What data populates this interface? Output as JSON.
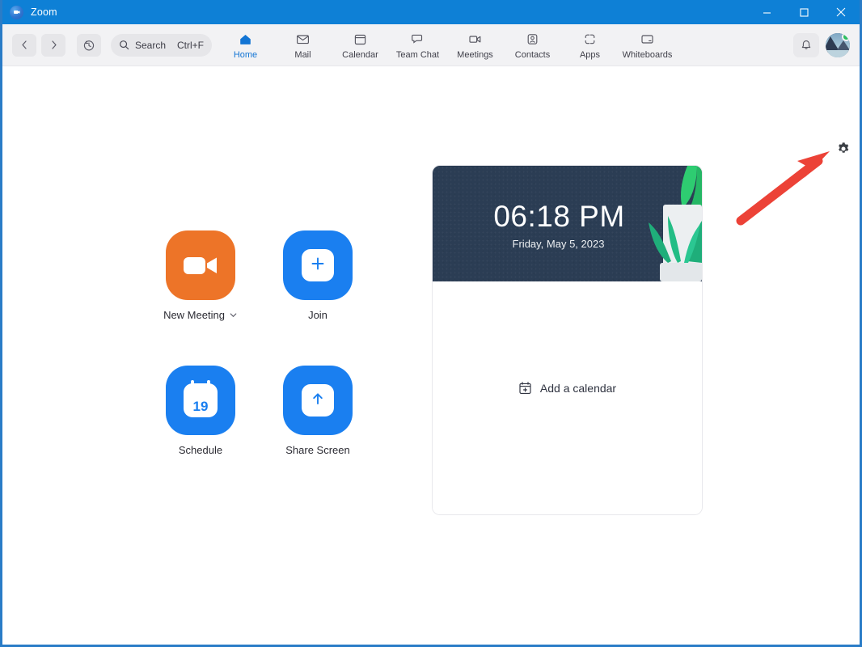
{
  "window": {
    "title": "Zoom",
    "logo_icon": "zoom-logo-icon",
    "controls": {
      "minimize": "minimize-icon",
      "maximize": "maximize-icon",
      "close": "close-icon"
    }
  },
  "toolbar": {
    "back_icon": "chevron-left-icon",
    "forward_icon": "chevron-right-icon",
    "history_icon": "history-clock-icon",
    "search": {
      "icon": "search-icon",
      "placeholder": "Search",
      "shortcut": "Ctrl+F"
    },
    "tabs": [
      {
        "label": "Home",
        "icon": "home-icon",
        "active": true
      },
      {
        "label": "Mail",
        "icon": "mail-envelope-icon",
        "active": false
      },
      {
        "label": "Calendar",
        "icon": "calendar-icon",
        "active": false
      },
      {
        "label": "Team Chat",
        "icon": "chat-bubbles-icon",
        "active": false
      },
      {
        "label": "Meetings",
        "icon": "video-camera-icon",
        "active": false
      },
      {
        "label": "Contacts",
        "icon": "contact-person-icon",
        "active": false
      },
      {
        "label": "Apps",
        "icon": "apps-grid-icon",
        "active": false
      },
      {
        "label": "Whiteboards",
        "icon": "whiteboard-screen-icon",
        "active": false
      }
    ],
    "notifications_icon": "bell-icon",
    "avatar_icon": "user-avatar",
    "status": "available"
  },
  "content": {
    "settings_icon": "gear-icon",
    "annotation_arrow": "red-arrow-pointing-to-settings",
    "actions": [
      {
        "label": "New Meeting",
        "icon": "video-camera-icon",
        "color": "#ed7428",
        "has_dropdown": true
      },
      {
        "label": "Join",
        "icon": "plus-icon",
        "color": "#1a7ff0",
        "has_dropdown": false
      },
      {
        "label": "Schedule",
        "icon": "calendar-day-icon",
        "color": "#1a7ff0",
        "has_dropdown": false,
        "day": "19"
      },
      {
        "label": "Share Screen",
        "icon": "up-arrow-icon",
        "color": "#1a7ff0",
        "has_dropdown": false
      }
    ],
    "calendar_card": {
      "time": "06:18 PM",
      "date": "Friday, May 5, 2023",
      "banner_color": "#2b3d54",
      "add_calendar_label": "Add a calendar",
      "add_calendar_icon": "calendar-add-icon"
    }
  },
  "colors": {
    "titlebar": "#0e80d6",
    "accent_blue": "#1a7ff0",
    "accent_orange": "#ed7428",
    "annotation_red": "#ec4237",
    "online_green": "#2bbf5e"
  }
}
